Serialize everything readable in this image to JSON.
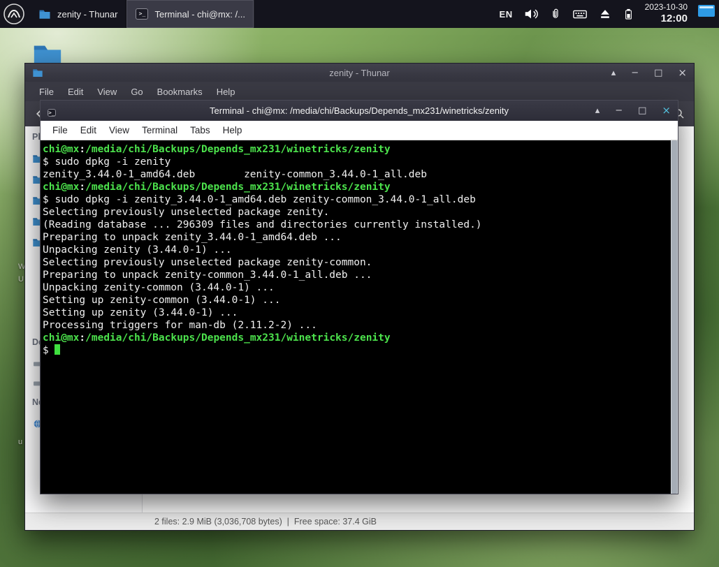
{
  "colors": {
    "panel_bg": "#14141d",
    "terminal_bg": "#000000",
    "terminal_fg": "#f0f0f0",
    "prompt_green": "#4ce24c",
    "close_button_blue": "#53c1de",
    "folder_blue": "#3f92d2"
  },
  "panel": {
    "tasks": [
      {
        "label": "zenity - Thunar",
        "icon": "folder-icon"
      },
      {
        "label": "Terminal - chi@mx: /...",
        "icon": "terminal-icon"
      }
    ],
    "tray": {
      "language": "EN",
      "icons": [
        "volume-icon",
        "paperclip-icon",
        "keyboard-icon",
        "eject-icon",
        "battery-icon",
        "blue-applet-icon"
      ],
      "date": "2023-10-30",
      "time": "12:00"
    }
  },
  "desktop": {
    "label_fragments": [
      "W",
      "U",
      "u"
    ]
  },
  "thunar": {
    "title": "zenity - Thunar",
    "window_controls": [
      "shade",
      "minimize",
      "maximize",
      "close"
    ],
    "menu": [
      "File",
      "Edit",
      "View",
      "Go",
      "Bookmarks",
      "Help"
    ],
    "toolbar_icons": [
      "back-arrow-icon",
      "search-icon"
    ],
    "sidebar": {
      "sections": [
        "Places",
        "Devices",
        "Network"
      ]
    },
    "statusbar": "2 files: 2.9 MiB (3,036,708 bytes)  |  Free space: 37.4 GiB"
  },
  "terminal": {
    "title": "Terminal - chi@mx: /media/chi/Backups/Depends_mx231/winetricks/zenity",
    "window_controls": [
      "shade",
      "minimize",
      "maximize",
      "close"
    ],
    "menu": [
      "File",
      "Edit",
      "View",
      "Terminal",
      "Tabs",
      "Help"
    ],
    "lines": [
      {
        "user": "chi@mx",
        "sep": ":",
        "path": "/media/chi/Backups/Depends_mx231/winetricks/zenity"
      },
      {
        "text": "$ sudo dpkg -i zenity"
      },
      {
        "text": "zenity_3.44.0-1_amd64.deb        zenity-common_3.44.0-1_all.deb"
      },
      {
        "user": "chi@mx",
        "sep": ":",
        "path": "/media/chi/Backups/Depends_mx231/winetricks/zenity"
      },
      {
        "text": "$ sudo dpkg -i zenity_3.44.0-1_amd64.deb zenity-common_3.44.0-1_all.deb"
      },
      {
        "text": "Selecting previously unselected package zenity."
      },
      {
        "text": "(Reading database ... 296309 files and directories currently installed.)"
      },
      {
        "text": "Preparing to unpack zenity_3.44.0-1_amd64.deb ..."
      },
      {
        "text": "Unpacking zenity (3.44.0-1) ..."
      },
      {
        "text": "Selecting previously unselected package zenity-common."
      },
      {
        "text": "Preparing to unpack zenity-common_3.44.0-1_all.deb ..."
      },
      {
        "text": "Unpacking zenity-common (3.44.0-1) ..."
      },
      {
        "text": "Setting up zenity-common (3.44.0-1) ..."
      },
      {
        "text": "Setting up zenity (3.44.0-1) ..."
      },
      {
        "text": "Processing triggers for man-db (2.11.2-2) ..."
      },
      {
        "user": "chi@mx",
        "sep": ":",
        "path": "/media/chi/Backups/Depends_mx231/winetricks/zenity"
      },
      {
        "text": "$ "
      }
    ]
  }
}
